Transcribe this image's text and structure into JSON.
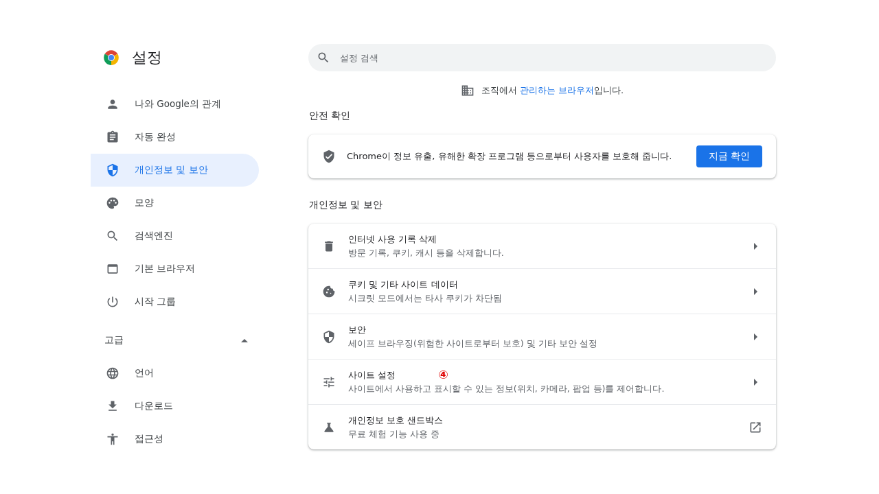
{
  "header": {
    "title": "설정"
  },
  "sidebar": {
    "items": [
      {
        "label": "나와 Google의 관계",
        "selected": false
      },
      {
        "label": "자동 완성",
        "selected": false
      },
      {
        "label": "개인정보 및 보안",
        "selected": true
      },
      {
        "label": "모양",
        "selected": false
      },
      {
        "label": "검색엔진",
        "selected": false
      },
      {
        "label": "기본 브라우저",
        "selected": false
      },
      {
        "label": "시작 그룹",
        "selected": false
      }
    ],
    "advanced": {
      "label": "고급",
      "expanded": true
    },
    "advanced_items": [
      {
        "label": "언어",
        "selected": false
      },
      {
        "label": "다운로드",
        "selected": false
      },
      {
        "label": "접근성",
        "selected": false
      }
    ]
  },
  "search": {
    "placeholder": "설정 검색"
  },
  "managed_notice": {
    "text_before": "조직에서 ",
    "link": "관리하는 브라우저",
    "text_after": "입니다."
  },
  "safety_check": {
    "heading": "안전 확인",
    "text": "Chrome이 정보 유출, 유해한 확장 프로그램 등으로부터 사용자를 보호해 줍니다.",
    "button": "지금 확인"
  },
  "privacy": {
    "heading": "개인정보 및 보안",
    "rows": [
      {
        "title": "인터넷 사용 기록 삭제",
        "subtitle": "방문 기록, 쿠키, 캐시 등을 삭제합니다.",
        "kind": "arrow"
      },
      {
        "title": "쿠키 및 기타 사이트 데이터",
        "subtitle": "시크릿 모드에서는 타사 쿠키가 차단됨",
        "kind": "arrow"
      },
      {
        "title": "보안",
        "subtitle": "세이프 브라우징(위험한 사이트로부터 보호) 및 기타 보안 설정",
        "kind": "arrow"
      },
      {
        "title": "사이트 설정",
        "subtitle": "사이트에서 사용하고 표시할 수 있는 정보(위치, 카메라, 팝업 등)를 제어합니다.",
        "kind": "arrow",
        "callout": "④"
      },
      {
        "title": "개인정보 보호 샌드박스",
        "subtitle": "무료 체험 기능 사용 중",
        "kind": "external"
      }
    ]
  }
}
